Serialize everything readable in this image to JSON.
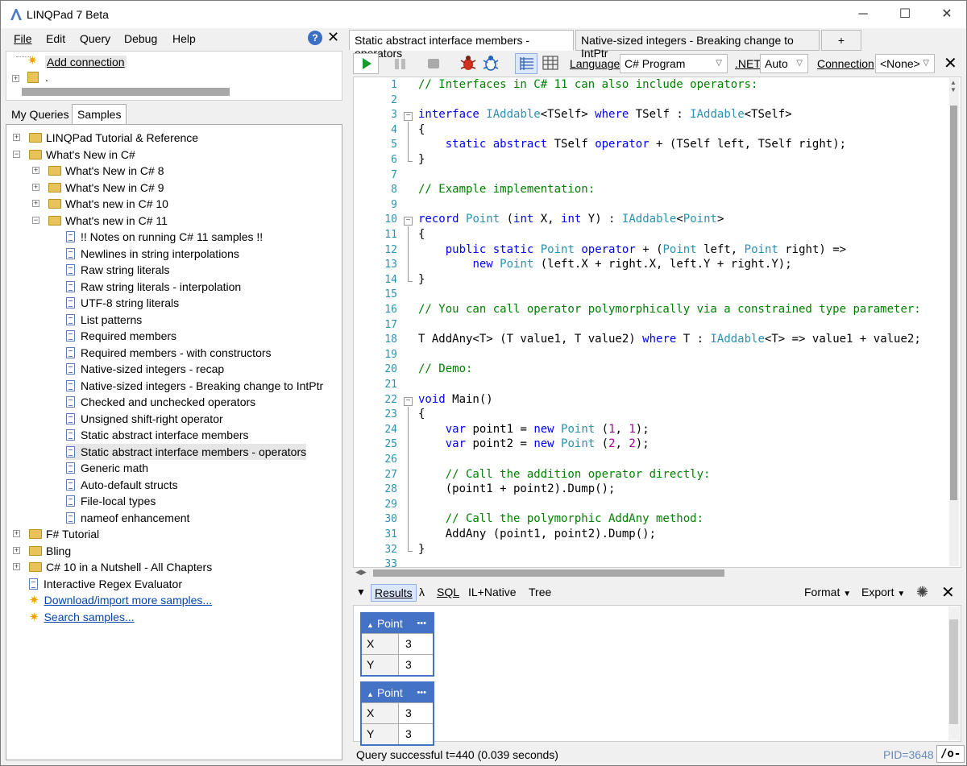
{
  "window": {
    "title": "LINQPad 7 Beta",
    "minimize": "─",
    "maximize": "☐",
    "close": "✕"
  },
  "menu": {
    "file": "File",
    "edit": "Edit",
    "query": "Query",
    "debug": "Debug",
    "help": "Help"
  },
  "connections": {
    "add": "Add connection",
    "local": "."
  },
  "left_tabs": [
    "My Queries",
    "Samples"
  ],
  "tree": [
    {
      "label": "LINQPad Tutorial & Reference",
      "type": "folder",
      "level": 0
    },
    {
      "label": "What's New in C#",
      "type": "folder-open",
      "level": 0
    },
    {
      "label": "What's New in C# 8",
      "type": "folder",
      "level": 1
    },
    {
      "label": "What's New in C# 9",
      "type": "folder",
      "level": 1
    },
    {
      "label": "What's new in C# 10",
      "type": "folder",
      "level": 1
    },
    {
      "label": "What's new in C# 11",
      "type": "folder-open",
      "level": 1
    },
    {
      "label": "!! Notes on running  C# 11 samples !!",
      "type": "doc",
      "level": 2
    },
    {
      "label": "Newlines in string interpolations",
      "type": "doc",
      "level": 2
    },
    {
      "label": "Raw string literals",
      "type": "doc",
      "level": 2
    },
    {
      "label": "Raw string literals - interpolation",
      "type": "doc",
      "level": 2
    },
    {
      "label": "UTF-8 string literals",
      "type": "doc",
      "level": 2
    },
    {
      "label": "List patterns",
      "type": "doc",
      "level": 2
    },
    {
      "label": "Required members",
      "type": "doc",
      "level": 2
    },
    {
      "label": "Required members - with constructors",
      "type": "doc",
      "level": 2
    },
    {
      "label": "Native-sized integers - recap",
      "type": "doc",
      "level": 2
    },
    {
      "label": "Native-sized integers - Breaking change to IntPtr",
      "type": "doc",
      "level": 2
    },
    {
      "label": "Checked and unchecked operators",
      "type": "doc",
      "level": 2
    },
    {
      "label": "Unsigned shift-right operator",
      "type": "doc",
      "level": 2
    },
    {
      "label": "Static abstract interface members",
      "type": "doc",
      "level": 2
    },
    {
      "label": "Static abstract interface members - operators",
      "type": "doc",
      "level": 2,
      "selected": true
    },
    {
      "label": "Generic math",
      "type": "doc",
      "level": 2
    },
    {
      "label": "Auto-default structs",
      "type": "doc",
      "level": 2
    },
    {
      "label": "File-local types",
      "type": "doc",
      "level": 2
    },
    {
      "label": "nameof enhancement",
      "type": "doc",
      "level": 2
    },
    {
      "label": "F# Tutorial",
      "type": "folder",
      "level": 0
    },
    {
      "label": "Bling",
      "type": "folder",
      "level": 0
    },
    {
      "label": "C# 10 in a Nutshell - All Chapters",
      "type": "folder",
      "level": 0
    },
    {
      "label": "Interactive Regex Evaluator",
      "type": "doc",
      "level": 0
    },
    {
      "label": "Download/import more samples...",
      "type": "link",
      "level": 0
    },
    {
      "label": "Search samples...",
      "type": "link",
      "level": 0
    }
  ],
  "doc_tabs": [
    {
      "label": "Static abstract interface members - operators",
      "active": true
    },
    {
      "label": "Native-sized integers - Breaking change to IntPtr",
      "active": false
    },
    {
      "label": "+",
      "active": false
    }
  ],
  "toolbar": {
    "language_label": "Language",
    "language_value": "C# Program",
    "net_label": ".NET",
    "net_value": "Auto",
    "connection_label": "Connection",
    "connection_value": "<None>"
  },
  "code_lines": [
    "// Interfaces in C# 11 can also include operators:",
    "",
    "interface IAddable<TSelf> where TSelf : IAddable<TSelf>",
    "{",
    "    static abstract TSelf operator + (TSelf left, TSelf right);",
    "}",
    "",
    "// Example implementation:",
    "",
    "record Point (int X, int Y) : IAddable<Point>",
    "{",
    "    public static Point operator + (Point left, Point right) =>",
    "        new Point (left.X + right.X, left.Y + right.Y);",
    "}",
    "",
    "// You can call operator polymorphically via a constrained type parameter:",
    "",
    "T AddAny<T> (T value1, T value2) where T : IAddable<T> => value1 + value2;",
    "",
    "// Demo:",
    "",
    "void Main()",
    "{",
    "    var point1 = new Point (1, 1);",
    "    var point2 = new Point (2, 2);",
    "",
    "    // Call the addition operator directly:",
    "    (point1 + point2).Dump();",
    "",
    "    // Call the polymorphic AddAny method:",
    "    AddAny (point1, point2).Dump();",
    "}",
    ""
  ],
  "results_bar": {
    "results": "Results",
    "lambda": "λ",
    "sql": "SQL",
    "il": "IL+Native",
    "tree": "Tree",
    "format": "Format",
    "export": "Export"
  },
  "results": [
    {
      "header": "Point",
      "more": "•••",
      "rows": [
        {
          "key": "X",
          "value": "3"
        },
        {
          "key": "Y",
          "value": "3"
        }
      ]
    },
    {
      "header": "Point",
      "more": "•••",
      "rows": [
        {
          "key": "X",
          "value": "3"
        },
        {
          "key": "Y",
          "value": "3"
        }
      ]
    }
  ],
  "status": {
    "message": "Query successful t=440  (0.039 seconds)",
    "pid": "PID=3648",
    "flag": "/o-"
  }
}
